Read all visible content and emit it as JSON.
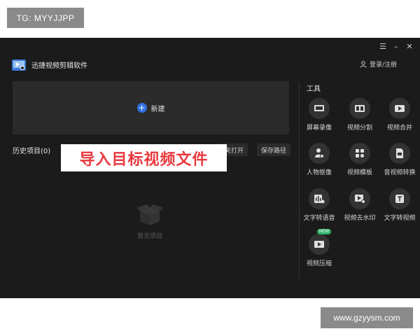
{
  "watermark": {
    "top": "TG: MYYJJPP",
    "bottom": "www.gzyysm.com"
  },
  "window_controls": {
    "menu": "☰",
    "minimize": "–",
    "close": "✕"
  },
  "app": {
    "title": "迅捷视频剪辑软件",
    "login": "登录/注册"
  },
  "new_project": {
    "label": "新建"
  },
  "history": {
    "title": "历史项目(0)",
    "open_folder": "件夹打开",
    "save_path": "保存路径",
    "empty_text": "暂无项目"
  },
  "overlay_text": "导入目标视频文件",
  "tools": {
    "title": "工具",
    "items": [
      {
        "label": "屏幕录像",
        "icon": "screen-record-icon"
      },
      {
        "label": "视频分割",
        "icon": "video-split-icon"
      },
      {
        "label": "视频合并",
        "icon": "video-merge-icon"
      },
      {
        "label": "人物抠像",
        "icon": "portrait-cutout-icon"
      },
      {
        "label": "视频模板",
        "icon": "video-template-icon"
      },
      {
        "label": "音视频转换",
        "icon": "av-convert-icon"
      },
      {
        "label": "文字转语音",
        "icon": "text-to-speech-icon"
      },
      {
        "label": "视频去水印",
        "icon": "remove-watermark-icon"
      },
      {
        "label": "文字转视频",
        "icon": "text-to-video-icon"
      },
      {
        "label": "视频压缩",
        "icon": "video-compress-icon",
        "badge": "NEW"
      }
    ]
  }
}
